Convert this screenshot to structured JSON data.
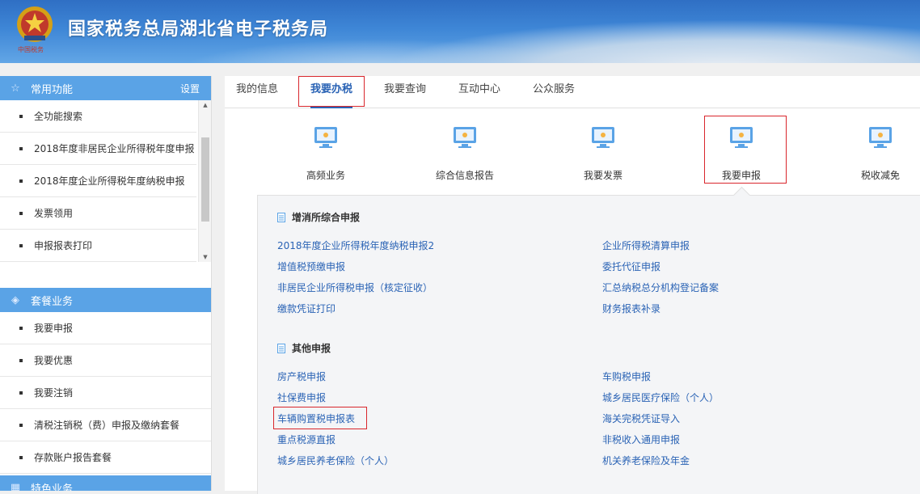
{
  "header": {
    "title": "国家税务总局湖北省电子税务局",
    "emblem_caption": "中国税务"
  },
  "sidebar": {
    "section1": {
      "title": "常用功能",
      "settings": "设置",
      "items": [
        "全功能搜索",
        "2018年度非居民企业所得税年度申报",
        "2018年度企业所得税年度纳税申报",
        "发票领用",
        "申报报表打印"
      ]
    },
    "section2": {
      "title": "套餐业务",
      "items": [
        "我要申报",
        "我要优惠",
        "我要注销",
        "清税注销税（费）申报及缴纳套餐",
        "存款账户报告套餐"
      ]
    },
    "section3": {
      "title": "特色业务"
    }
  },
  "tabs": [
    "我的信息",
    "我要办税",
    "我要查询",
    "互动中心",
    "公众服务"
  ],
  "cards": [
    "高频业务",
    "综合信息报告",
    "我要发票",
    "我要申报",
    "税收减免"
  ],
  "dropdown": {
    "section1": {
      "title": "增消所综合申报",
      "left": [
        "2018年度企业所得税年度纳税申报2",
        "增值税预缴申报",
        "非居民企业所得税申报（核定征收）",
        "缴款凭证打印"
      ],
      "right": [
        "企业所得税清算申报",
        "委托代征申报",
        "汇总纳税总分机构登记备案",
        "财务报表补录"
      ]
    },
    "section2": {
      "title": "其他申报",
      "left": [
        "房产税申报",
        "社保费申报",
        "车辆购置税申报表",
        "重点税源直报",
        "城乡居民养老保险（个人）"
      ],
      "right": [
        "车购税申报",
        "城乡居民医疗保险（个人）",
        "海关完税凭证导入",
        "非税收入通用申报",
        "机关养老保险及年金"
      ]
    }
  },
  "colors": {
    "header_blue": "#2f6fc4",
    "sidebar_head": "#5aa3e6",
    "link_blue": "#2a63b5",
    "highlight_red": "#d9262c"
  }
}
